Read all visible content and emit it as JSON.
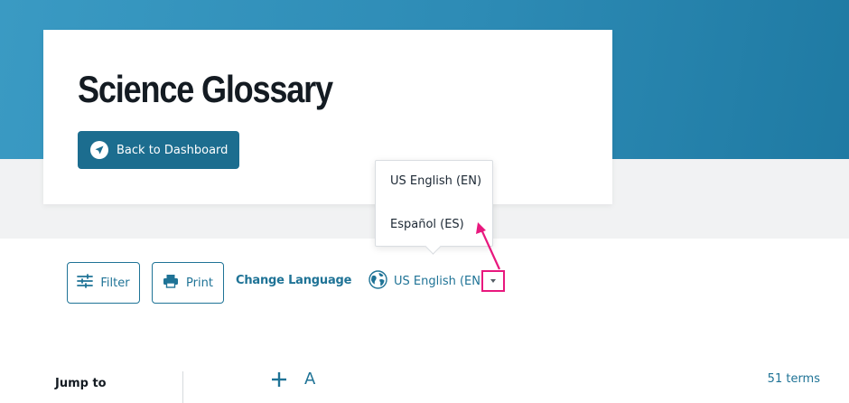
{
  "header": {
    "title": "Science Glossary",
    "back_button_label": "Back to Dashboard"
  },
  "toolbar": {
    "filter_label": "Filter",
    "print_label": "Print",
    "change_language_label": "Change Language",
    "current_language": "US English (EN)"
  },
  "language_menu": {
    "options": [
      "US English (EN)",
      "Español (ES)"
    ]
  },
  "glossary": {
    "jump_to_label": "Jump to",
    "expand_symbol": "+",
    "current_letter": "A",
    "term_count": "51 terms"
  },
  "colors": {
    "hero_blue": "#2d8bb5",
    "primary_button": "#1c6d8f",
    "accent_text": "#1f7396",
    "annotation_highlight": "#e8187e"
  },
  "icons": {
    "back": "send-arrow-icon",
    "filter": "sliders-icon",
    "print": "printer-icon",
    "language": "globe-icon",
    "dropdown": "chevron-down-icon",
    "expand": "plus-icon"
  }
}
